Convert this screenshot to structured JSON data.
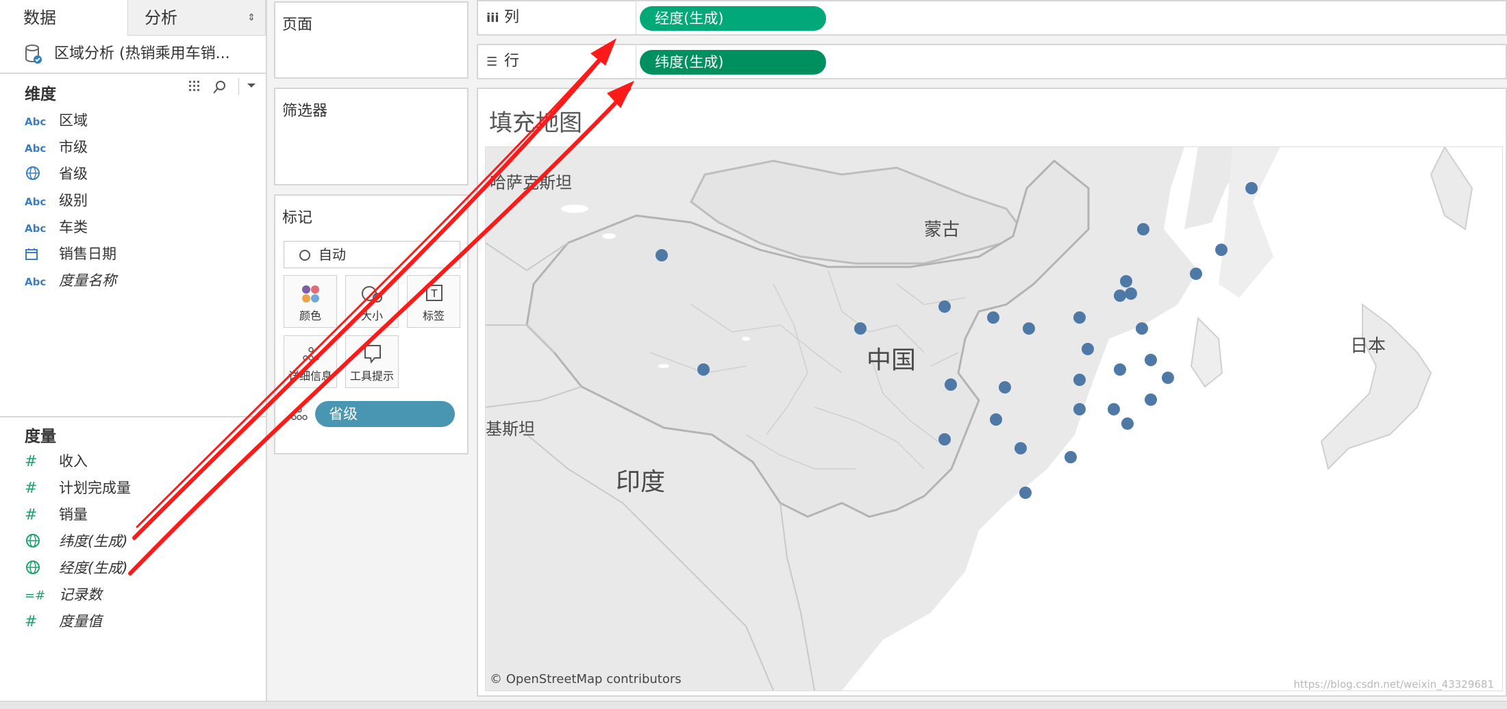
{
  "tabs": {
    "data": "数据",
    "analysis": "分析",
    "analysis_arrows": "⇕"
  },
  "datasource": {
    "name": "区域分析 (热销乘用车销..."
  },
  "dimensions": {
    "title": "维度",
    "items": [
      {
        "type": "Abc",
        "label": "区域",
        "italic": false
      },
      {
        "type": "Abc",
        "label": "市级",
        "italic": false
      },
      {
        "type": "globe",
        "label": "省级",
        "italic": false
      },
      {
        "type": "Abc",
        "label": "级别",
        "italic": false
      },
      {
        "type": "Abc",
        "label": "车类",
        "italic": false
      },
      {
        "type": "date",
        "label": "销售日期",
        "italic": false
      },
      {
        "type": "Abc",
        "label": "度量名称",
        "italic": true
      }
    ]
  },
  "measures": {
    "title": "度量",
    "items": [
      {
        "type": "#",
        "label": "收入",
        "italic": false
      },
      {
        "type": "#",
        "label": "计划完成量",
        "italic": false
      },
      {
        "type": "#",
        "label": "销量",
        "italic": false
      },
      {
        "type": "globe",
        "label": "纬度(生成)",
        "italic": true
      },
      {
        "type": "globe",
        "label": "经度(生成)",
        "italic": true
      },
      {
        "type": "=#",
        "label": "记录数",
        "italic": true
      },
      {
        "type": "#",
        "label": "度量值",
        "italic": true
      }
    ]
  },
  "cards": {
    "pages": "页面",
    "filters": "筛选器",
    "marks": "标记",
    "mark_type": "自动",
    "buttons": {
      "color": "颜色",
      "size": "大小",
      "label": "标签",
      "detail": "详细信息",
      "tooltip": "工具提示"
    },
    "detail_pill": "省级"
  },
  "shelves": {
    "columns": {
      "label": "列",
      "pill": "经度(生成)"
    },
    "rows": {
      "label": "行",
      "pill": "纬度(生成)"
    }
  },
  "colors": {
    "accent_columns": "#00a977",
    "accent_rows": "#00905f",
    "geo_pill": "#4996b2",
    "marks": "#4e79a7",
    "arrows": "#ff1a1a"
  },
  "view": {
    "title": "填充地图",
    "labels": {
      "kazakhstan": "哈萨克斯坦",
      "mongolia": "蒙古",
      "china": "中国",
      "japan": "日本",
      "pakistan": "基斯坦",
      "india": "印度"
    },
    "attribution": "© OpenStreetMap contributors",
    "watermark": "https://blog.csdn.net/weixin_43329681"
  }
}
